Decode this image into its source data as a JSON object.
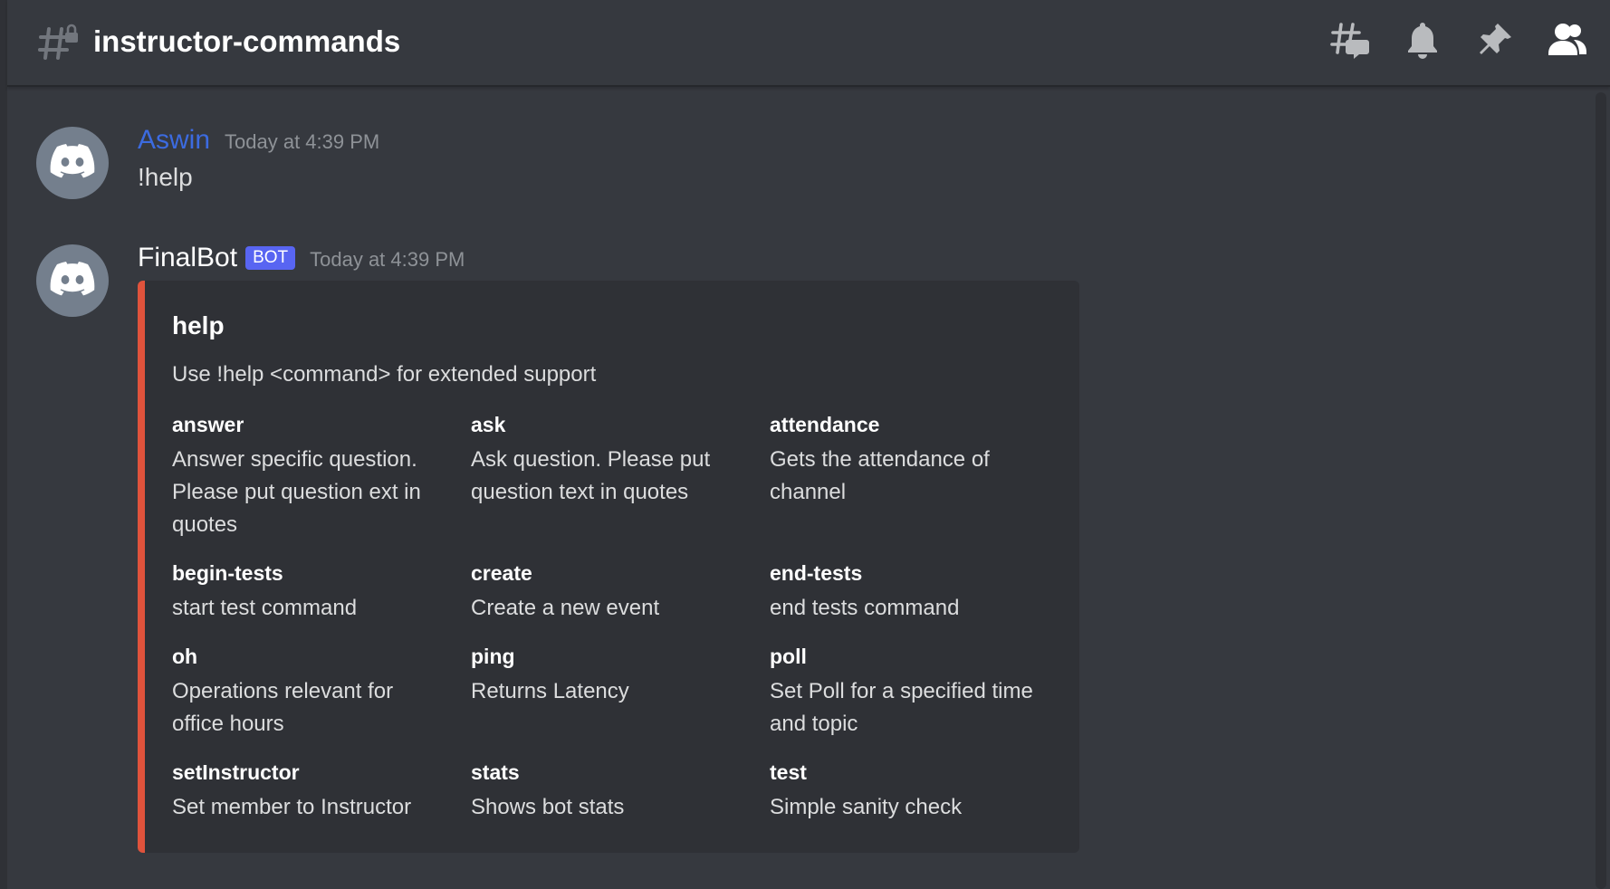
{
  "channel": {
    "name": "instructor-commands",
    "icon": "hashtag-lock-icon"
  },
  "toolbar": {
    "threads_icon": "threads-icon",
    "notifications_icon": "bell-icon",
    "pins_icon": "pin-icon",
    "members_icon": "members-icon"
  },
  "messages": [
    {
      "author": "Aswin",
      "author_color": "#3c6be0",
      "timestamp": "Today at 4:39 PM",
      "content": "!help",
      "avatar_icon": "discord-logo-icon"
    },
    {
      "author": "FinalBot",
      "badge": "BOT",
      "timestamp": "Today at 4:39 PM",
      "avatar_icon": "discord-logo-icon",
      "embed": {
        "accent_color": "#e0533c",
        "title": "help",
        "description": "Use !help <command> for extended support",
        "fields": [
          {
            "name": "answer",
            "value": "Answer specific question. Please put question ext in quotes"
          },
          {
            "name": "ask",
            "value": "Ask question. Please put question text in quotes"
          },
          {
            "name": "attendance",
            "value": "Gets the attendance of channel"
          },
          {
            "name": "begin-tests",
            "value": "start test command"
          },
          {
            "name": "create",
            "value": "Create a new event"
          },
          {
            "name": "end-tests",
            "value": "end tests command"
          },
          {
            "name": "oh",
            "value": "Operations relevant for office hours"
          },
          {
            "name": "ping",
            "value": "Returns Latency"
          },
          {
            "name": "poll",
            "value": "Set Poll for a specified time and topic"
          },
          {
            "name": "setInstructor",
            "value": "Set member to Instructor"
          },
          {
            "name": "stats",
            "value": "Shows bot stats"
          },
          {
            "name": "test",
            "value": "Simple sanity check"
          }
        ]
      }
    }
  ]
}
